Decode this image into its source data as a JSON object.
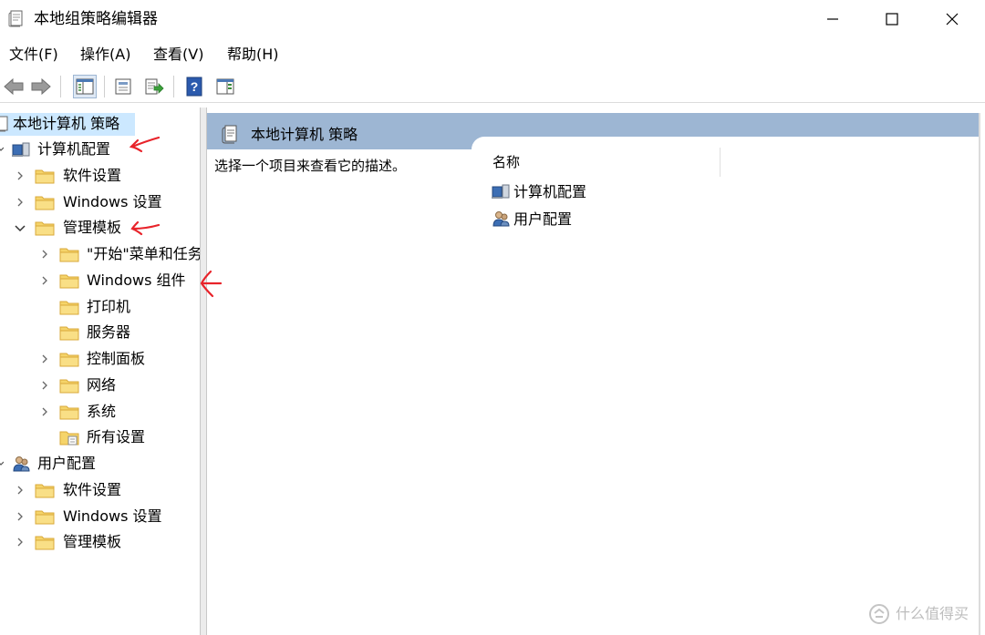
{
  "window": {
    "title": "本地组策略编辑器"
  },
  "menu": {
    "file": "文件(F)",
    "action": "操作(A)",
    "view": "查看(V)",
    "help": "帮助(H)"
  },
  "tree": {
    "root": "本地计算机 策略",
    "computer_config": "计算机配置",
    "software_settings": "软件设置",
    "windows_settings": "Windows 设置",
    "admin_templates": "管理模板",
    "start_menu": "\"开始\"菜单和任务栏",
    "windows_components": "Windows 组件",
    "printers": "打印机",
    "servers": "服务器",
    "control_panel": "控制面板",
    "network": "网络",
    "system": "系统",
    "all_settings": "所有设置",
    "user_config": "用户配置",
    "user_software_settings": "软件设置",
    "user_windows_settings": "Windows 设置",
    "user_admin_templates": "管理模板"
  },
  "right_pane": {
    "header": "本地计算机 策略",
    "description": "选择一个项目来查看它的描述。",
    "column_name": "名称",
    "items": [
      "计算机配置",
      "用户配置"
    ]
  },
  "watermark": {
    "text": "什么值得买"
  },
  "colors": {
    "header_bg": "#9db6d3",
    "selection_bg": "#cce8ff",
    "annotation": "#e8232a",
    "folder": "#f5d46a"
  }
}
